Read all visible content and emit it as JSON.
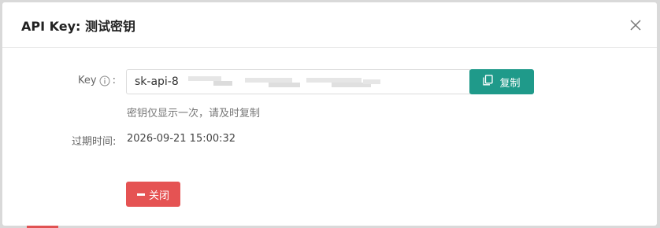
{
  "dialog": {
    "title": "API Key: 测试密钥",
    "close_icon": "close-x-icon"
  },
  "key_field": {
    "label": "Key",
    "info_icon": "info-circle-icon",
    "value": "sk-api-8",
    "hint": "密钥仅显示一次，请及时复制"
  },
  "copy_button": {
    "label": "复制",
    "icon": "copy-icon"
  },
  "expire": {
    "label": "过期时间:",
    "value": "2026-09-21 15:00:32"
  },
  "close_button": {
    "label": "关闭",
    "icon": "minus-icon"
  },
  "colors": {
    "copy_button": "#1f9a8a",
    "close_button": "#e55353"
  }
}
